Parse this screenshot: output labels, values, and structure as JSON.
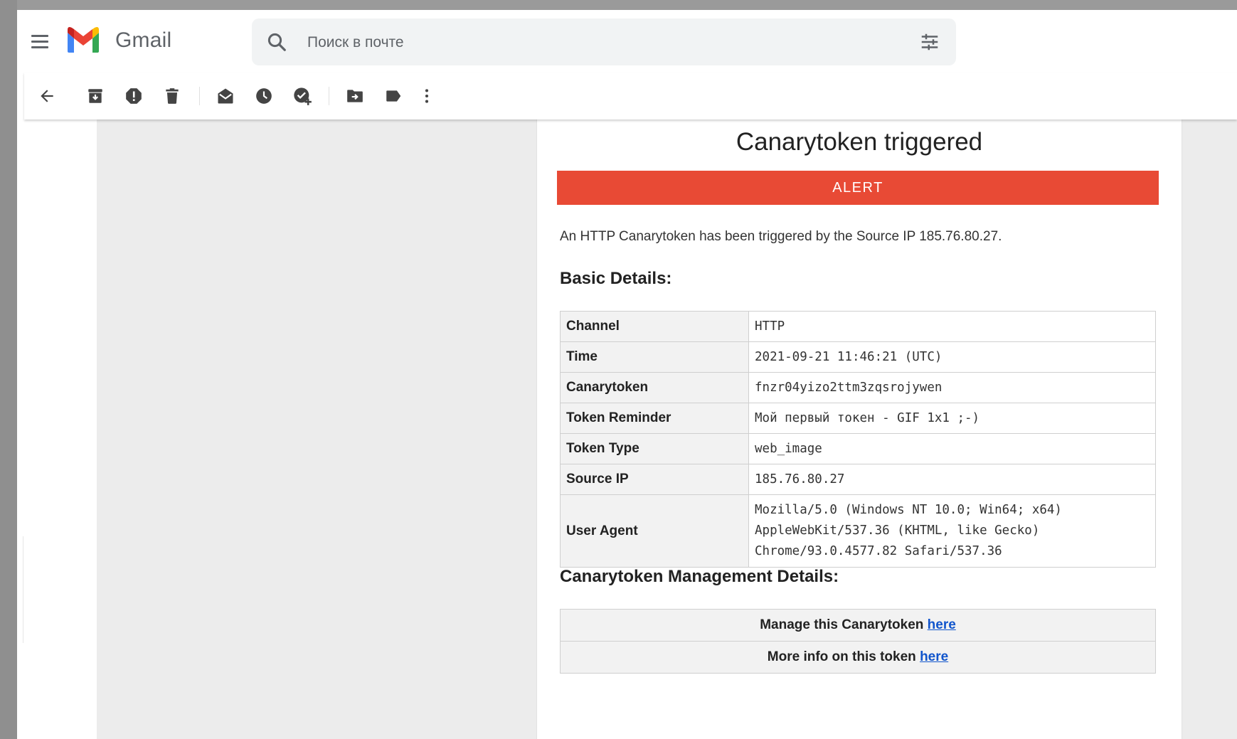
{
  "app": {
    "brand": "Gmail",
    "search_placeholder": "Поиск в почте"
  },
  "toolbar": {
    "icons": [
      "back-arrow-icon",
      "archive-icon",
      "report-spam-icon",
      "delete-icon",
      "mark-unread-icon",
      "snooze-icon",
      "add-to-tasks-icon",
      "move-to-icon",
      "label-icon",
      "more-vert-icon"
    ]
  },
  "email": {
    "title": "Canarytoken triggered",
    "alert_label": "ALERT",
    "alert_color": "#e84a35",
    "intro": "An HTTP Canarytoken has been triggered by the Source IP 185.76.80.27.",
    "basic_heading": "Basic Details:",
    "details": [
      {
        "key": "Channel",
        "value": "HTTP"
      },
      {
        "key": "Time",
        "value": "2021-09-21 11:46:21 (UTC)"
      },
      {
        "key": "Canarytoken",
        "value": "fnzr04yizo2ttm3zqsrojywen"
      },
      {
        "key": "Token Reminder",
        "value": "Мой первый токен - GIF 1x1 ;-)"
      },
      {
        "key": "Token Type",
        "value": "web_image"
      },
      {
        "key": "Source IP",
        "value": "185.76.80.27"
      },
      {
        "key": "User Agent",
        "lines": [
          "Mozilla/5.0 (Windows NT 10.0; Win64; x64)",
          "AppleWebKit/537.36 (KHTML, like Gecko)",
          "Chrome/93.0.4577.82 Safari/537.36"
        ]
      }
    ],
    "mgmt_heading": "Canarytoken Management Details:",
    "mgmt": [
      {
        "text": "Manage this Canarytoken ",
        "link": "here"
      },
      {
        "text": "More info on this token ",
        "link": "here"
      }
    ],
    "link_color": "#1155cc"
  }
}
